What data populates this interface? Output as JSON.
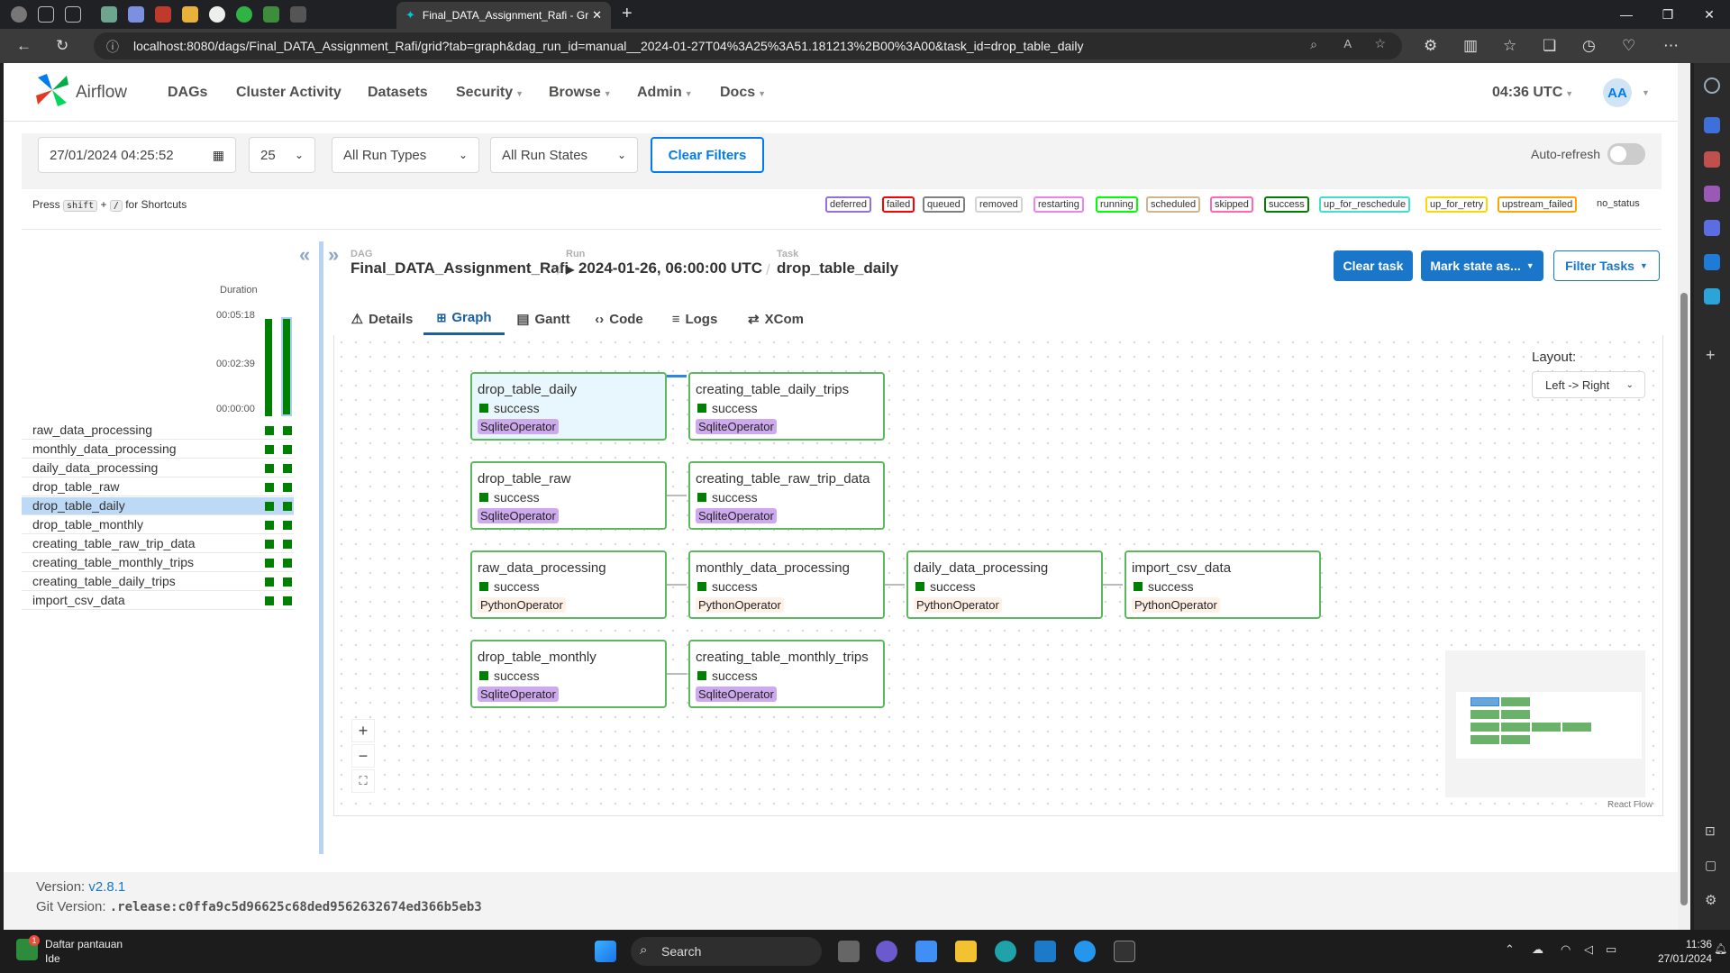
{
  "browser": {
    "tab_title": "Final_DATA_Assignment_Rafi - Gr",
    "url": "localhost:8080/dags/Final_DATA_Assignment_Rafi/grid?tab=graph&dag_run_id=manual__2024-01-27T04%3A25%3A51.181213%2B00%3A00&task_id=drop_table_daily"
  },
  "navbar": {
    "brand": "Airflow",
    "items": [
      "DAGs",
      "Cluster Activity",
      "Datasets",
      "Security",
      "Browse",
      "Admin",
      "Docs"
    ],
    "clock": "04:36 UTC",
    "avatar": "AA"
  },
  "filters": {
    "date": "27/01/2024  04:25:52",
    "num_runs": "25",
    "run_types": "All Run Types",
    "run_states": "All Run States",
    "clear_label": "Clear Filters",
    "autorefresh_label": "Auto-refresh"
  },
  "shortcuts": {
    "press": "Press",
    "key1": "shift",
    "plus": "+",
    "key2": "/",
    "suffix": "for Shortcuts"
  },
  "legend": [
    "deferred",
    "failed",
    "queued",
    "removed",
    "restarting",
    "running",
    "scheduled",
    "skipped",
    "success",
    "up_for_reschedule",
    "up_for_retry",
    "upstream_failed",
    "no_status"
  ],
  "grid": {
    "duration_label": "Duration",
    "ticks": [
      "00:05:18",
      "00:02:39",
      "00:00:00"
    ],
    "tasks": [
      "raw_data_processing",
      "monthly_data_processing",
      "daily_data_processing",
      "drop_table_raw",
      "drop_table_daily",
      "drop_table_monthly",
      "creating_table_raw_trip_data",
      "creating_table_monthly_trips",
      "creating_table_daily_trips",
      "import_csv_data"
    ]
  },
  "breadcrumb": {
    "dag_label": "DAG",
    "dag": "Final_DATA_Assignment_Rafi",
    "run_label": "Run",
    "run": "2024-01-26, 06:00:00 UTC",
    "task_label": "Task",
    "task": "drop_table_daily"
  },
  "actions": {
    "clear_task": "Clear task",
    "mark_state": "Mark state as...",
    "filter_tasks": "Filter Tasks"
  },
  "tabs": [
    "Details",
    "Graph",
    "Gantt",
    "Code",
    "Logs",
    "XCom"
  ],
  "graph": {
    "layout_label": "Layout:",
    "layout_value": "Left -> Right",
    "status": "success",
    "nodes": [
      {
        "title": "drop_table_daily",
        "op": "SqliteOperator"
      },
      {
        "title": "creating_table_daily_trips",
        "op": "SqliteOperator"
      },
      {
        "title": "drop_table_raw",
        "op": "SqliteOperator"
      },
      {
        "title": "creating_table_raw_trip_data",
        "op": "SqliteOperator"
      },
      {
        "title": "raw_data_processing",
        "op": "PythonOperator"
      },
      {
        "title": "monthly_data_processing",
        "op": "PythonOperator"
      },
      {
        "title": "daily_data_processing",
        "op": "PythonOperator"
      },
      {
        "title": "import_csv_data",
        "op": "PythonOperator"
      },
      {
        "title": "drop_table_monthly",
        "op": "SqliteOperator"
      },
      {
        "title": "creating_table_monthly_trips",
        "op": "SqliteOperator"
      }
    ],
    "reactflow": "React Flow"
  },
  "footer": {
    "version_label": "Version:",
    "version": "v2.8.1",
    "git_label": "Git Version:",
    "git": ".release:c0ffa9c5d96625c68ded9562632674ed366b5eb3"
  },
  "taskbar": {
    "watch_title": "Daftar pantauan",
    "watch_sub": "Ide",
    "search": "Search",
    "time": "11:36",
    "date": "27/01/2024"
  }
}
